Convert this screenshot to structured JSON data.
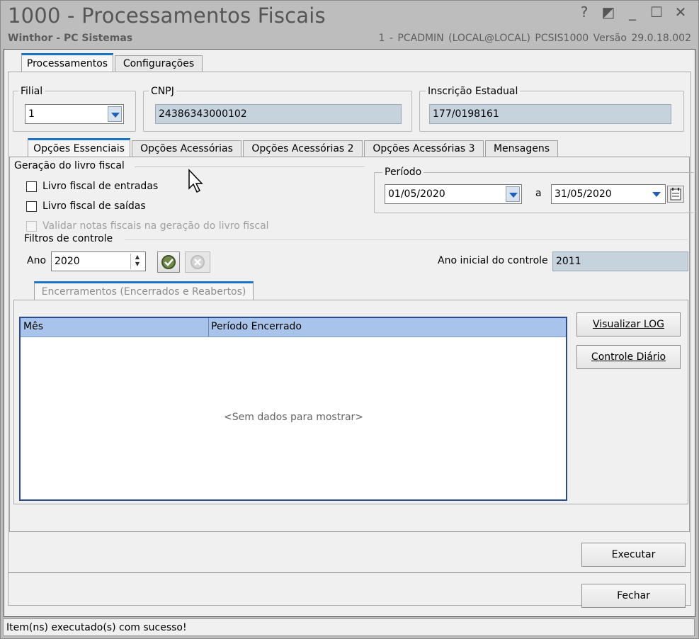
{
  "window": {
    "title": "1000 - Processamentos Fiscais",
    "subtitle": "Winthor - PC Sistemas",
    "user_info": "1 - PCADMIN (LOCAL@LOCAL)   PCSIS1000  Versão  29.0.18.002",
    "controls": {
      "help": "?",
      "restore_icon": "◩",
      "minimize": "_",
      "maximize": "☐",
      "close": "✕"
    }
  },
  "main_tabs": [
    {
      "label": "Processamentos",
      "active": true
    },
    {
      "label": "Configurações",
      "active": false
    }
  ],
  "header_fields": {
    "filial": {
      "label": "Filial",
      "value": "1"
    },
    "cnpj": {
      "label": "CNPJ",
      "value": "24386343000102"
    },
    "inscricao": {
      "label": "Inscrição Estadual",
      "value": "177/0198161"
    }
  },
  "sub_tabs": [
    {
      "label": "Opções Essenciais",
      "active": true
    },
    {
      "label": "Opções Acessórias",
      "active": false
    },
    {
      "label": "Opções Acessórias 2",
      "active": false
    },
    {
      "label": "Opções Acessórias 3",
      "active": false
    },
    {
      "label": "Mensagens",
      "active": false
    }
  ],
  "geracao": {
    "title": "Geração do livro fiscal",
    "opt_entradas": "Livro fiscal de entradas",
    "opt_saidas": "Livro fiscal de saídas",
    "opt_validar": "Validar notas fiscais na geração do livro fiscal"
  },
  "periodo": {
    "title": "Período",
    "start": "01/05/2020",
    "separator": "a",
    "end": "31/05/2020"
  },
  "filtros": {
    "title": "Filtros de controle",
    "ano_label": "Ano",
    "ano_value": "2020",
    "ano_inicial_label": "Ano inicial do controle",
    "ano_inicial_value": "2011"
  },
  "encerramentos": {
    "tab_label": "Encerramentos (Encerrados e Reabertos)",
    "columns": [
      "Mês",
      "Período Encerrado"
    ],
    "empty_text": "<Sem dados para mostrar>",
    "btn_log": "Visualizar LOG",
    "btn_diario": "Controle Diário"
  },
  "actions": {
    "executar": "Executar",
    "fechar": "Fechar"
  },
  "status": {
    "message": "Item(ns) executado(s) com sucesso!"
  },
  "colors": {
    "tab_accent": "#1a73c8",
    "readonly_field": "#c6d3dd",
    "grid_header": "#a9c4ea"
  }
}
